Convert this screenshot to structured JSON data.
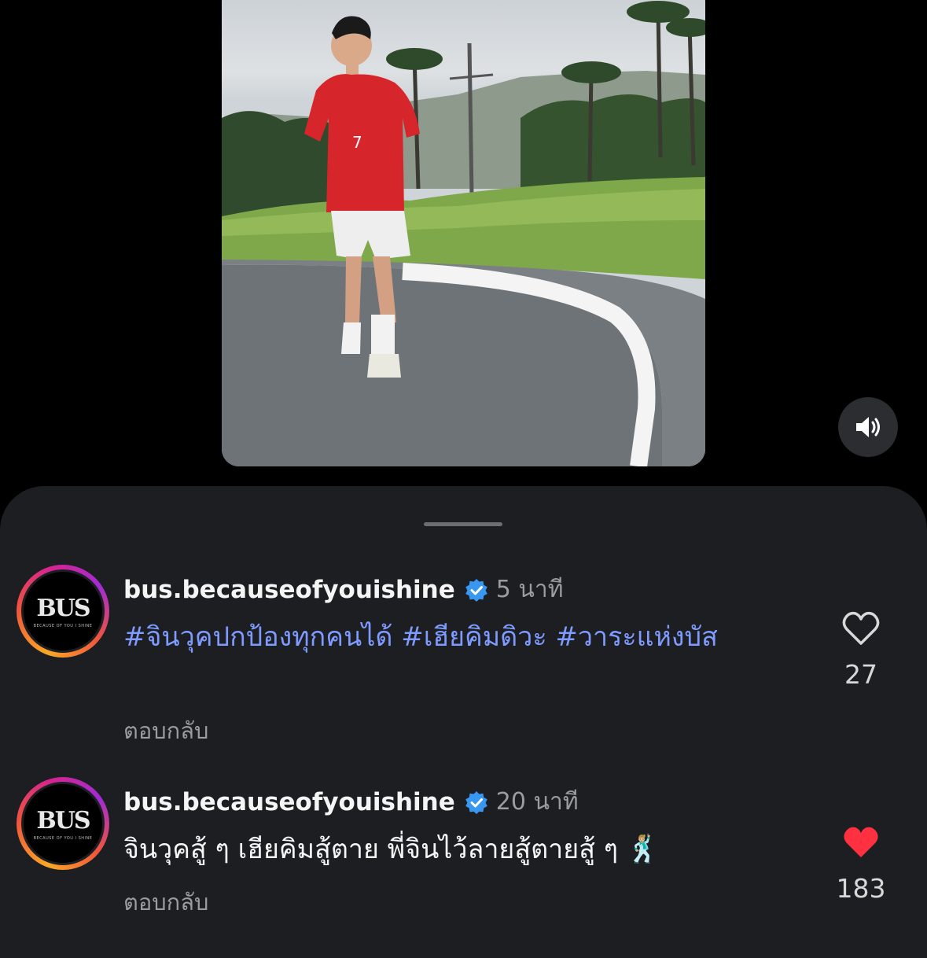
{
  "video": {
    "sound_icon": "speaker-icon"
  },
  "comments": [
    {
      "username": "bus.becauseofyouishine",
      "time": "5 นาที",
      "text": "#จินวุคปกป้องทุกคนได้ #เฮียคิมดิวะ #วาระแห่งบัส",
      "reply_label": "ตอบกลับ",
      "likes": "27",
      "liked": false,
      "avatar_logo": "BUS",
      "avatar_tagline": "BECAUSE OF YOU I SHINE"
    },
    {
      "username": "bus.becauseofyouishine",
      "time": "20 นาที",
      "text": "จินวุคสู้ ๆ เฮียคิมสู้ตาย พี่จินไว้ลายสู้ตายสู้ ๆ 🕺🏼",
      "reply_label": "ตอบกลับ",
      "likes": "183",
      "liked": true,
      "avatar_logo": "BUS",
      "avatar_tagline": "BECAUSE OF YOU I SHINE"
    }
  ],
  "colors": {
    "hashtag": "#7f9bff",
    "liked_heart": "#ff3040",
    "sheet_bg": "#1c1e22"
  }
}
